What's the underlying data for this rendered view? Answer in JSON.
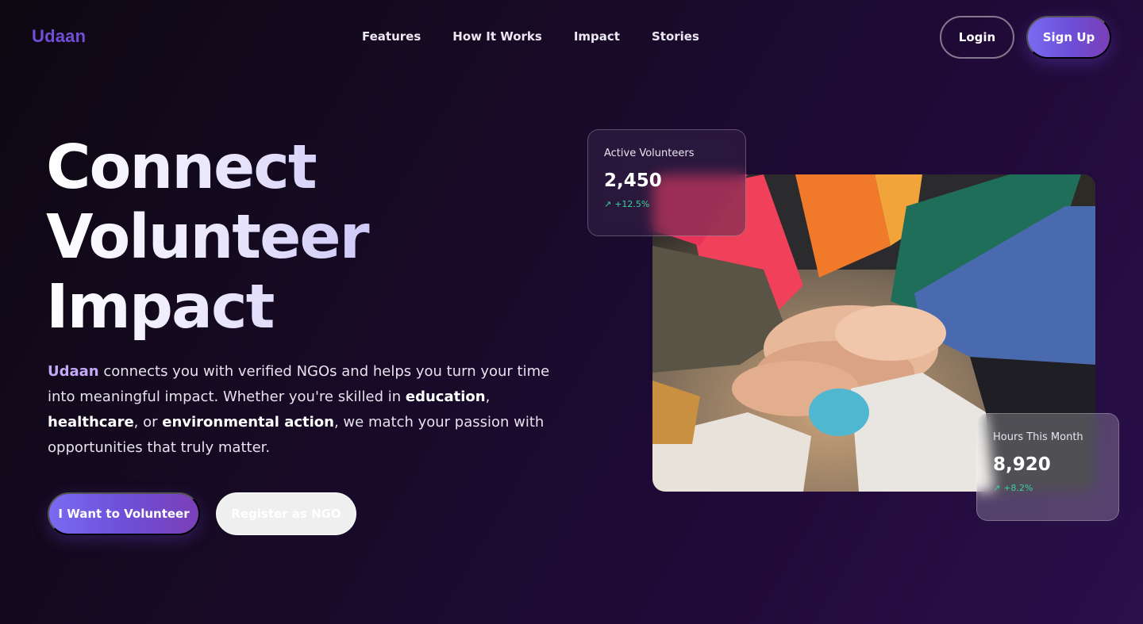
{
  "nav": {
    "brand": "Udaan",
    "links": [
      "Features",
      "How It Works",
      "Impact",
      "Stories"
    ],
    "login_label": "Login",
    "signup_label": "Sign Up"
  },
  "hero": {
    "title_lines": [
      "Connect",
      "Volunteer",
      "Impact"
    ],
    "description": {
      "brand_word": "Udaan",
      "part1": " connects you with verified NGOs and helps you turn your time into meaningful impact. Whether you're skilled in ",
      "bold1": "education",
      "part2": ", ",
      "bold2": "healthcare",
      "part3": ", or ",
      "bold3": "environmental action",
      "part4": ", we match your passion with opportunities that truly matter."
    },
    "primary_button": "I Want to Volunteer",
    "secondary_button": "Register as NGO"
  },
  "stats": [
    {
      "label": "Active Volunteers",
      "value": "2,450",
      "change": "+12.5%",
      "icon": "trend-up-arrow-icon"
    },
    {
      "label": "Hours This Month",
      "value": "8,920",
      "change": "+8.2%",
      "icon": "trend-up-arrow-icon"
    }
  ],
  "colors": {
    "accent": "#6d4fd8",
    "brand": "#6f4fd6",
    "positive": "#34d399",
    "background_dark": "#0d0812",
    "background_purple": "#2a0f4a"
  }
}
